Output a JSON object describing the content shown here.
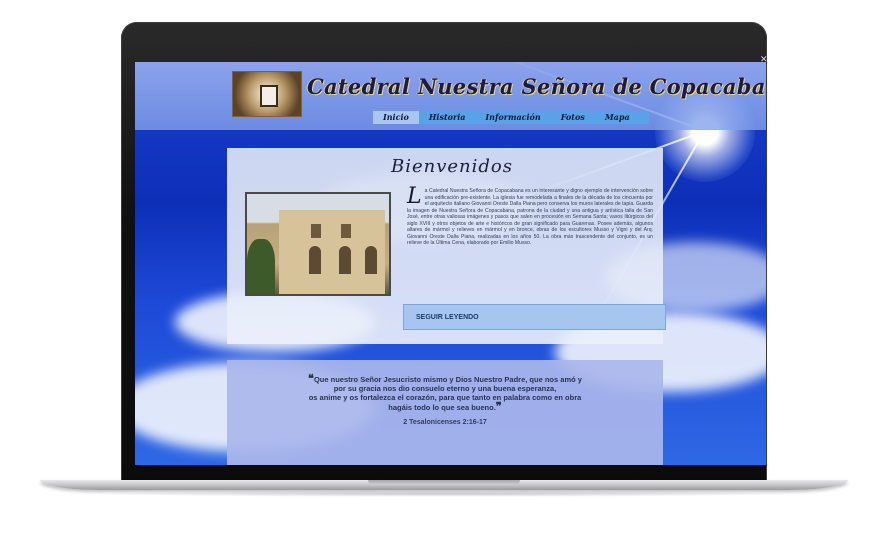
{
  "site": {
    "title": "Catedral Nuestra Señora de Copacabana"
  },
  "nav": {
    "items": [
      "Inicio",
      "Historia",
      "Información",
      "Fotos",
      "Mapa"
    ],
    "active": "Inicio"
  },
  "welcome": {
    "heading": "Bienvenidos",
    "dropcap": "L",
    "body": "a Catedral Nuestra Señora de Copacabana es un interesante y digno ejemplo de intervención sobre una edificación pre-existente. La iglesia fue remodelada a finales de la década de los cincuenta por el arquitecto italiano Giovanni Oreste Dalla Piana pero conserva los muros laterales de tapia. Guarda la imagen de Nuestra Señora de Copacabana, patrona de la ciudad y una antigua y artística talla de San José, entre otras valiosas imágenes y pasos que salen en procesión en Semana Santa; vasos litúrgicos del siglo XVIII y otros objetos de arte e históricos de gran significado para Guarenas. Posee además, algunos altares de mármol y relieves en mármol y en bronce, obras de los escultores Musso y Vigni y del Arq. Giovanni Oreste Dalla Piana, realizadas en los años 50. La obra más trascendente del conjunto, es un relieve de la Última Cena, elaborado por Emilio Musso.",
    "read_more": "SEGUIR LEYENDO"
  },
  "quote": {
    "open_mark": "❝",
    "close_mark": "❞",
    "lines": [
      "Que nuestro Señor Jesucristo mismo y Dios Nuestro Padre, que nos amó y",
      "por su gracia nos dio consuelo eterno y una buena esperanza,",
      "os anime y os fortalezca el corazón, para que tanto en palabra como en obra",
      "hagáis todo lo que sea bueno."
    ],
    "reference": "2 Tesalonicenses 2:16-17"
  },
  "colors": {
    "sky": "#1a3ed0",
    "nav": "#5aa2e8",
    "read_more": "#a6c6f0",
    "quote_panel": "#aab6ec"
  }
}
